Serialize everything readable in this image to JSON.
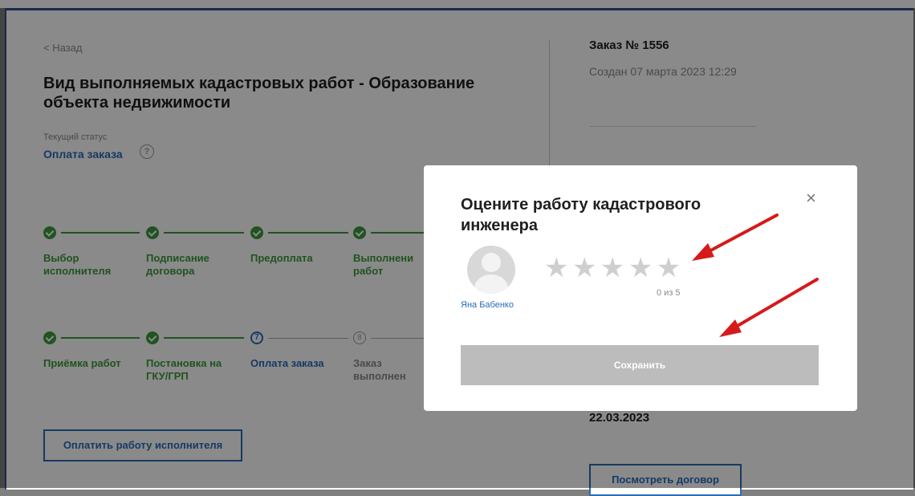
{
  "page": {
    "back_label": "< Назад",
    "title": "Вид выполняемых кадастровых работ - Образование объекта недвижимости",
    "status_caption": "Текущий статус",
    "status_value": "Оплата заказа",
    "help_symbol": "?"
  },
  "order": {
    "title": "Заказ № 1556",
    "created": "Создан 07 марта 2023 12:29",
    "date": "22.03.2023",
    "view_contract_label": "Посмотреть договор"
  },
  "steps_row1": [
    {
      "label": "Выбор исполнителя",
      "state": "done"
    },
    {
      "label": "Подписание договора",
      "state": "done"
    },
    {
      "label": "Предоплата",
      "state": "done"
    },
    {
      "label": "Выполнени работ",
      "state": "done"
    }
  ],
  "steps_row2": [
    {
      "label": "Приёмка работ",
      "state": "done",
      "marker": ""
    },
    {
      "label": "Постановка на ГКУ/ГРП",
      "state": "done",
      "marker": ""
    },
    {
      "label": "Оплата заказа",
      "state": "current",
      "marker": "7"
    },
    {
      "label": "Заказ выполнен",
      "state": "pending",
      "marker": "8"
    }
  ],
  "pay_button_label": "Оплатить работу исполнителя",
  "modal": {
    "title": "Оцените работу кадастрового инженера",
    "close_symbol": "×",
    "engineer_name": "Яна Бабенко",
    "star_symbol": "★",
    "rating": 0,
    "max_rating": 5,
    "rating_text": "0 из 5",
    "save_label": "Сохранить"
  },
  "colors": {
    "accent_blue": "#2a6bb8",
    "done_green": "#3b9a3b",
    "annotation_red": "#d61a1a",
    "disabled_button": "#bcbcbc"
  }
}
